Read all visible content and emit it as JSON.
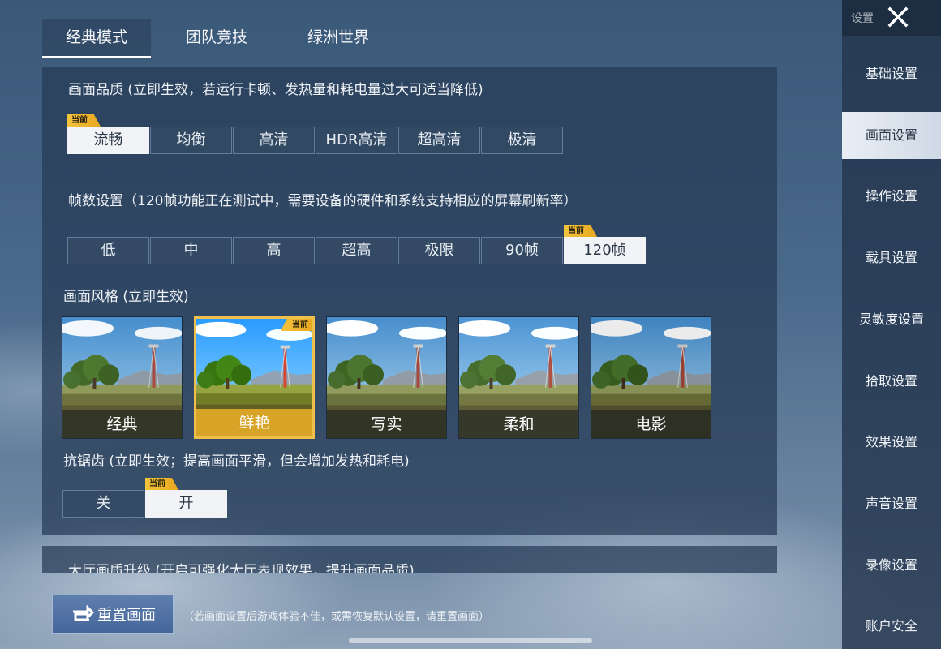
{
  "tabs": [
    "经典模式",
    "团队竞技",
    "绿洲世界"
  ],
  "current_badge": "当前",
  "quality": {
    "title": "画面品质 (立即生效，若运行卡顿、发热量和耗电量过大可适当降低)",
    "options": [
      "流畅",
      "均衡",
      "高清",
      "HDR高清",
      "超高清",
      "极清"
    ],
    "selected": "流畅"
  },
  "fps": {
    "title": "帧数设置（120帧功能正在测试中，需要设备的硬件和系统支持相应的屏幕刷新率）",
    "options": [
      "低",
      "中",
      "高",
      "超高",
      "极限",
      "90帧",
      "120帧"
    ],
    "selected": "120帧"
  },
  "style": {
    "title": "画面风格 (立即生效)",
    "options": [
      "经典",
      "鲜艳",
      "写实",
      "柔和",
      "电影"
    ],
    "selected": "鲜艳"
  },
  "antialias": {
    "title": "抗锯齿 (立即生效；提高画面平滑，但会增加发热和耗电)",
    "options": [
      "关",
      "开"
    ],
    "selected": "开"
  },
  "lobby": {
    "title": "大厅画质升级 (开启可强化大厅表现效果，提升画面品质)"
  },
  "reset": {
    "label": "重置画面",
    "hint": "（若画面设置后游戏体验不佳，或需恢复默认设置，请重置画面）",
    "icon": "reset-icon"
  },
  "sidebar": {
    "title": "设置",
    "close_icon": "close-icon",
    "items": [
      "基础设置",
      "画面设置",
      "操作设置",
      "载具设置",
      "灵敏度设置",
      "拾取设置",
      "效果设置",
      "声音设置",
      "录像设置",
      "账户安全"
    ],
    "active": "画面设置"
  },
  "colors": {
    "badge": "#f0b52e",
    "selected_bg": "#f1f3f6",
    "panel": "#263a54"
  }
}
